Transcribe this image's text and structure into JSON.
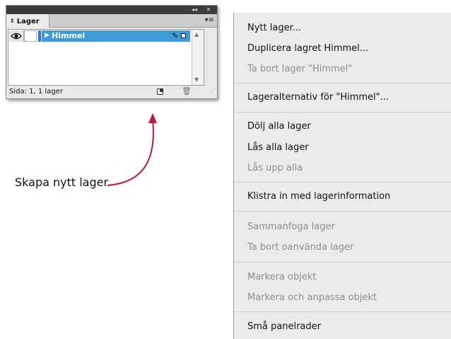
{
  "panel": {
    "topbar": {
      "collapse_glyph": "◂◂",
      "close_glyph": "✕"
    },
    "tab_label": "Lager",
    "tab_arrows_glyph": "⇕",
    "menu_glyph": "▾≡",
    "layer": {
      "name": "Himmel",
      "visibility_icon": "eye-icon",
      "expand_icon": "triangle-right-icon",
      "pen_icon": "pen-icon",
      "accent_color": "#3e9bd6"
    },
    "status": "Sida: 1, 1 lager",
    "new_layer_icon": "new-layer-icon",
    "delete_icon": "trash-icon"
  },
  "annotation": {
    "text": "Skapa nytt lager",
    "arrow_color": "#c0143c"
  },
  "menu": {
    "items": [
      {
        "label": "Nytt lager...",
        "enabled": true
      },
      {
        "label": "Duplicera lagret Himmel...",
        "enabled": true
      },
      {
        "label": "Ta bort lager \"Himmel\"",
        "enabled": false
      },
      {
        "label": "Lageralternativ för \"Himmel\"...",
        "enabled": true
      },
      {
        "label": "Dölj alla lager",
        "enabled": true
      },
      {
        "label": "Lås alla lager",
        "enabled": true
      },
      {
        "label": "Lås upp alla",
        "enabled": false
      },
      {
        "label": "Klistra in med lagerinformation",
        "enabled": true
      },
      {
        "label": "Sammanfoga lager",
        "enabled": false
      },
      {
        "label": "Ta bort oanvända lager",
        "enabled": false
      },
      {
        "label": "Markera objekt",
        "enabled": false
      },
      {
        "label": "Markera och anpassa objekt",
        "enabled": false
      },
      {
        "label": "Små panelrader",
        "enabled": true
      }
    ]
  }
}
